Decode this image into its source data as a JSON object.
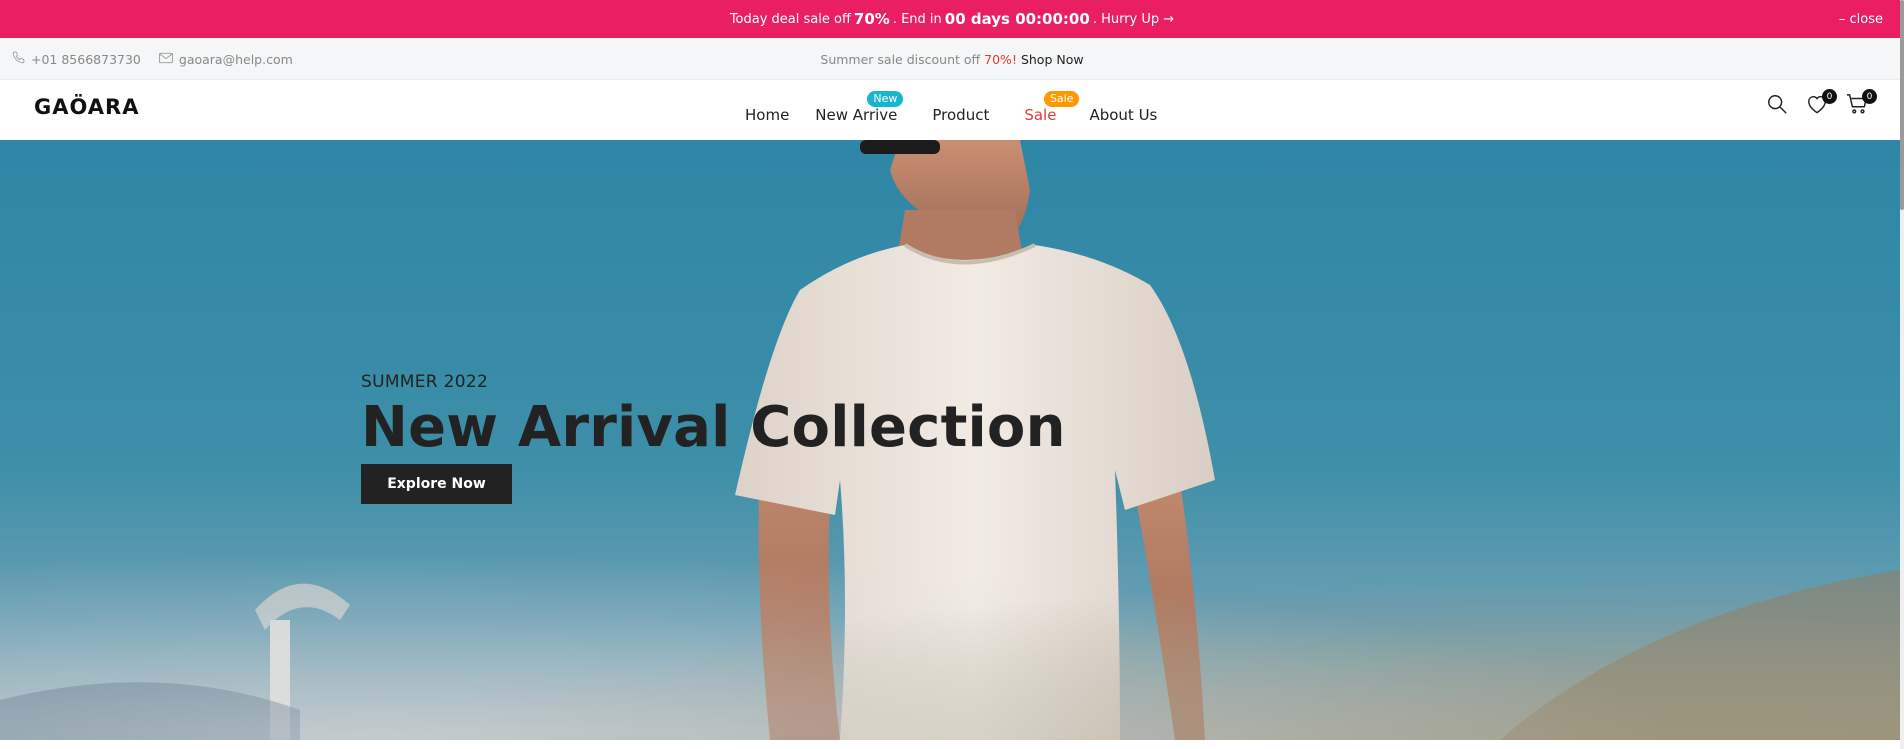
{
  "promo": {
    "prefix": "Today deal sale off",
    "discount": "70%",
    "mid": ". End in",
    "countdown": "00 days 00:00:00",
    "suffix": ". Hurry Up →",
    "close": "– close",
    "bg_color": "#e91e63"
  },
  "info": {
    "phone": "+01 8566873730",
    "email": "gaoara@help.com",
    "sale_text": "Summer sale discount off",
    "sale_pct": "70%",
    "sale_excl": "!",
    "shop_now": "Shop Now"
  },
  "header": {
    "logo": "GAÖARA",
    "nav": [
      {
        "label": "Home"
      },
      {
        "label": "New Arrive",
        "badge": "New"
      },
      {
        "label": "Product"
      },
      {
        "label": "Sale",
        "badge": "Sale"
      },
      {
        "label": "About Us"
      }
    ],
    "wishlist_count": "0",
    "cart_count": "0",
    "icons": [
      "search-icon",
      "heart-icon",
      "cart-icon"
    ]
  },
  "hero": {
    "kicker": "SUMMER 2022",
    "title": "New Arrival Collection",
    "button": "Explore Now"
  }
}
